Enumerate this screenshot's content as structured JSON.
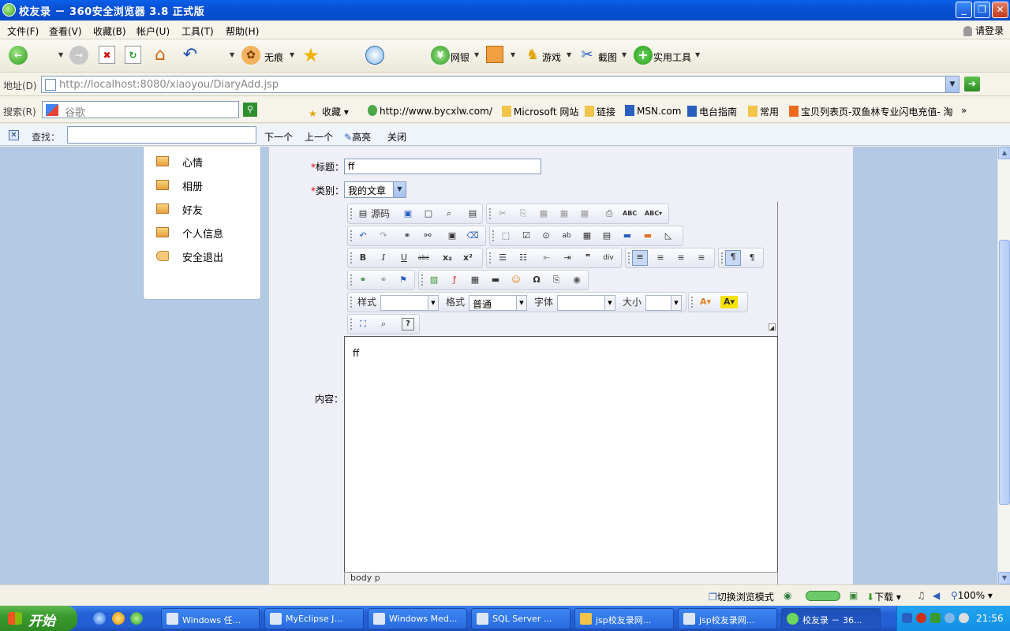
{
  "window": {
    "title": "校友录 － 360安全浏览器 3.8 正式版"
  },
  "menu": {
    "items": [
      "文件(F)",
      "查看(V)",
      "收藏(B)",
      "帐户(U)",
      "工具(T)",
      "帮助(H)"
    ],
    "login": "请登录"
  },
  "toolbar": {
    "incognito": "无痕",
    "netbank": "网银",
    "games": "游戏",
    "screenshot": "截图",
    "tools": "实用工具"
  },
  "address": {
    "label": "地址(D)",
    "url": "http://localhost:8080/xiaoyou/DiaryAdd.jsp"
  },
  "searchbar": {
    "label": "搜索(R)",
    "placeholder": "谷歌",
    "favorites": "收藏",
    "links": [
      "http://www.bycxlw.com/",
      "Microsoft 网站",
      "链接",
      "MSN.com",
      "电台指南",
      "常用",
      "宝贝列表页-双鱼林专业闪电充值- 淘"
    ]
  },
  "findbar": {
    "label": "查找：",
    "value": "",
    "next": "下一个",
    "prev": "上一个",
    "highlight": "高亮",
    "close": "关闭"
  },
  "sidebar": {
    "items": [
      "心情",
      "相册",
      "好友",
      "个人信息",
      "安全退出"
    ]
  },
  "form": {
    "title_label": "标题：",
    "title_value": "ff",
    "category_label": "类别：",
    "category_value": "我的文章",
    "content_label": "内容：",
    "required_mark": "*"
  },
  "editor": {
    "source_label": "源码",
    "style_label": "样式",
    "format_label": "格式",
    "format_value": "普通",
    "font_label": "字体",
    "size_label": "大小",
    "body_text": "ff",
    "status_path": "body  p"
  },
  "statusbar": {
    "switch_mode": "切换浏览模式",
    "download": "下载",
    "zoom": "100%"
  },
  "taskbar": {
    "start": "开始",
    "tasks": [
      "Windows 任...",
      "MyEclipse J...",
      "Windows Med...",
      "SQL Server ...",
      "jsp校友录网...",
      "jsp校友录网...",
      "校友录 － 36..."
    ],
    "clock": "21:56"
  },
  "colors": {
    "title_bar": "#0A5FE8",
    "content_bg": "#B4C9E4",
    "form_bg": "#EFEFF7",
    "taskbar": "#245ED4",
    "start_button": "#3A9A2E",
    "required": "#DD0000"
  }
}
